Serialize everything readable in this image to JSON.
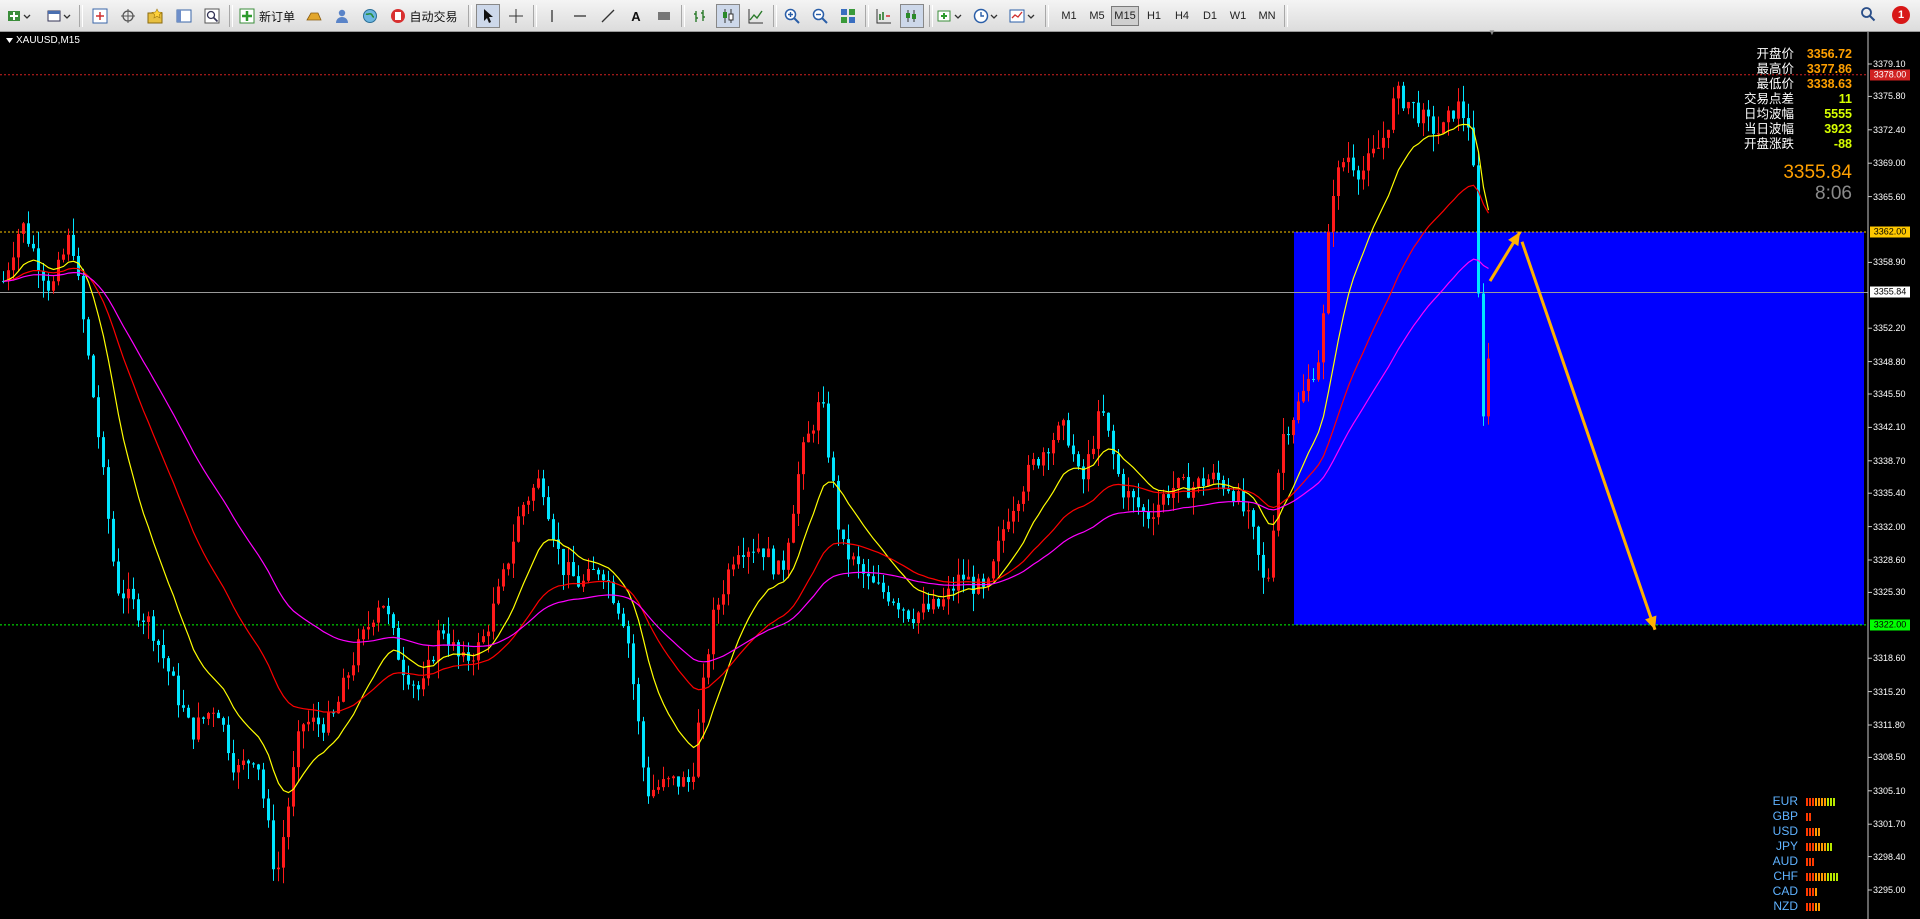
{
  "toolbar": {
    "new_order": "新订单",
    "auto_trading": "自动交易",
    "timeframes": [
      "M1",
      "M5",
      "M15",
      "H1",
      "H4",
      "D1",
      "W1",
      "MN"
    ],
    "active_timeframe": "M15",
    "notification_count": "1"
  },
  "chart": {
    "symbol_title": "XAUUSD,M15",
    "price_scale": [
      "3379.10",
      "3375.80",
      "3372.40",
      "3369.00",
      "3365.60",
      "3358.90",
      "3352.20",
      "3348.80",
      "3345.50",
      "3342.10",
      "3338.70",
      "3335.40",
      "3332.00",
      "3328.60",
      "3325.30",
      "3318.60",
      "3315.20",
      "3311.80",
      "3308.50",
      "3305.10",
      "3301.70",
      "3298.40",
      "3295.00"
    ],
    "price_tags": {
      "high_line": "3378.00",
      "resistance": "3362.00",
      "current": "3355.84",
      "support": "3322.00"
    },
    "colors": {
      "background": "#000000",
      "bull_candle": "#ff1a1a",
      "bear_candle": "#00e5ff",
      "ma_fast": "#ffff00",
      "ma_mid": "#ff0000",
      "ma_slow": "#ff00ff",
      "zone": "#0000ff",
      "arrow": "#ffb000",
      "resistance_line": "#ffc800",
      "support_line": "#00ff00"
    }
  },
  "info_panel": [
    {
      "label": "开盘价",
      "value": "3356.72"
    },
    {
      "label": "最高价",
      "value": "3377.86"
    },
    {
      "label": "最低价",
      "value": "3338.63"
    },
    {
      "label": "交易点差",
      "value": "11"
    },
    {
      "label": "日均波幅",
      "value": "5555"
    },
    {
      "label": "当日波幅",
      "value": "3923"
    },
    {
      "label": "开盘涨跌",
      "value": "-88"
    }
  ],
  "current_price": "3355.84",
  "countdown": "8:06",
  "currency_strength": [
    {
      "name": "EUR",
      "level": 10
    },
    {
      "name": "GBP",
      "level": 2
    },
    {
      "name": "USD",
      "level": 5
    },
    {
      "name": "JPY",
      "level": 9
    },
    {
      "name": "AUD",
      "level": 3
    },
    {
      "name": "CHF",
      "level": 11
    },
    {
      "name": "CAD",
      "level": 4
    },
    {
      "name": "NZD",
      "level": 5
    }
  ]
}
